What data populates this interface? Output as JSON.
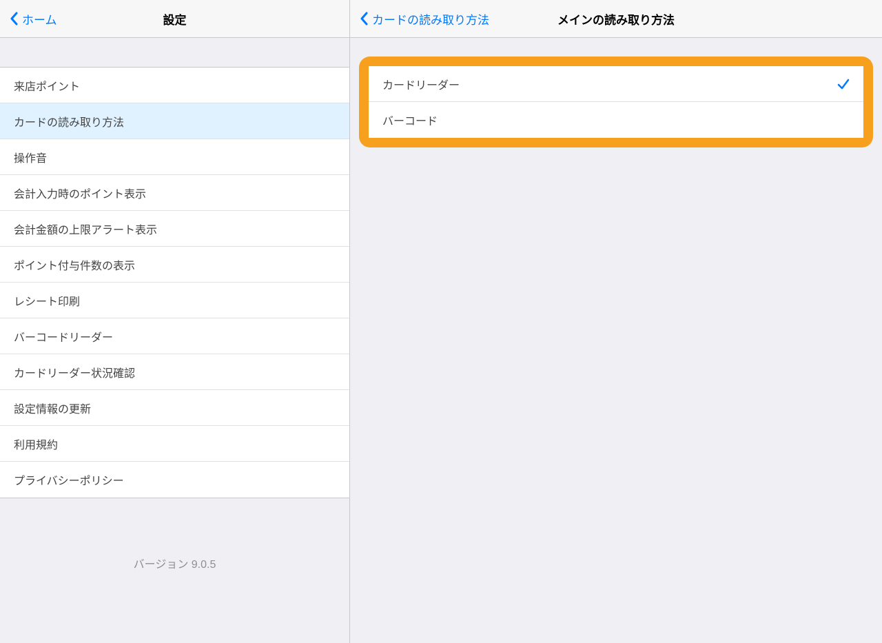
{
  "left": {
    "back_label": "ホーム",
    "title": "設定",
    "items": [
      {
        "label": "来店ポイント",
        "selected": false
      },
      {
        "label": "カードの読み取り方法",
        "selected": true
      },
      {
        "label": "操作音",
        "selected": false
      },
      {
        "label": "会計入力時のポイント表示",
        "selected": false
      },
      {
        "label": "会計金額の上限アラート表示",
        "selected": false
      },
      {
        "label": "ポイント付与件数の表示",
        "selected": false
      },
      {
        "label": "レシート印刷",
        "selected": false
      },
      {
        "label": "バーコードリーダー",
        "selected": false
      },
      {
        "label": "カードリーダー状況確認",
        "selected": false
      },
      {
        "label": "設定情報の更新",
        "selected": false
      },
      {
        "label": "利用規約",
        "selected": false
      },
      {
        "label": "プライバシーポリシー",
        "selected": false
      }
    ],
    "version": "バージョン 9.0.5"
  },
  "right": {
    "back_label": "カードの読み取り方法",
    "title": "メインの読み取り方法",
    "options": [
      {
        "label": "カードリーダー",
        "checked": true
      },
      {
        "label": "バーコード",
        "checked": false
      }
    ]
  },
  "colors": {
    "accent": "#007aff",
    "highlight": "#f7a01d",
    "selected_bg": "#e0f2ff"
  }
}
